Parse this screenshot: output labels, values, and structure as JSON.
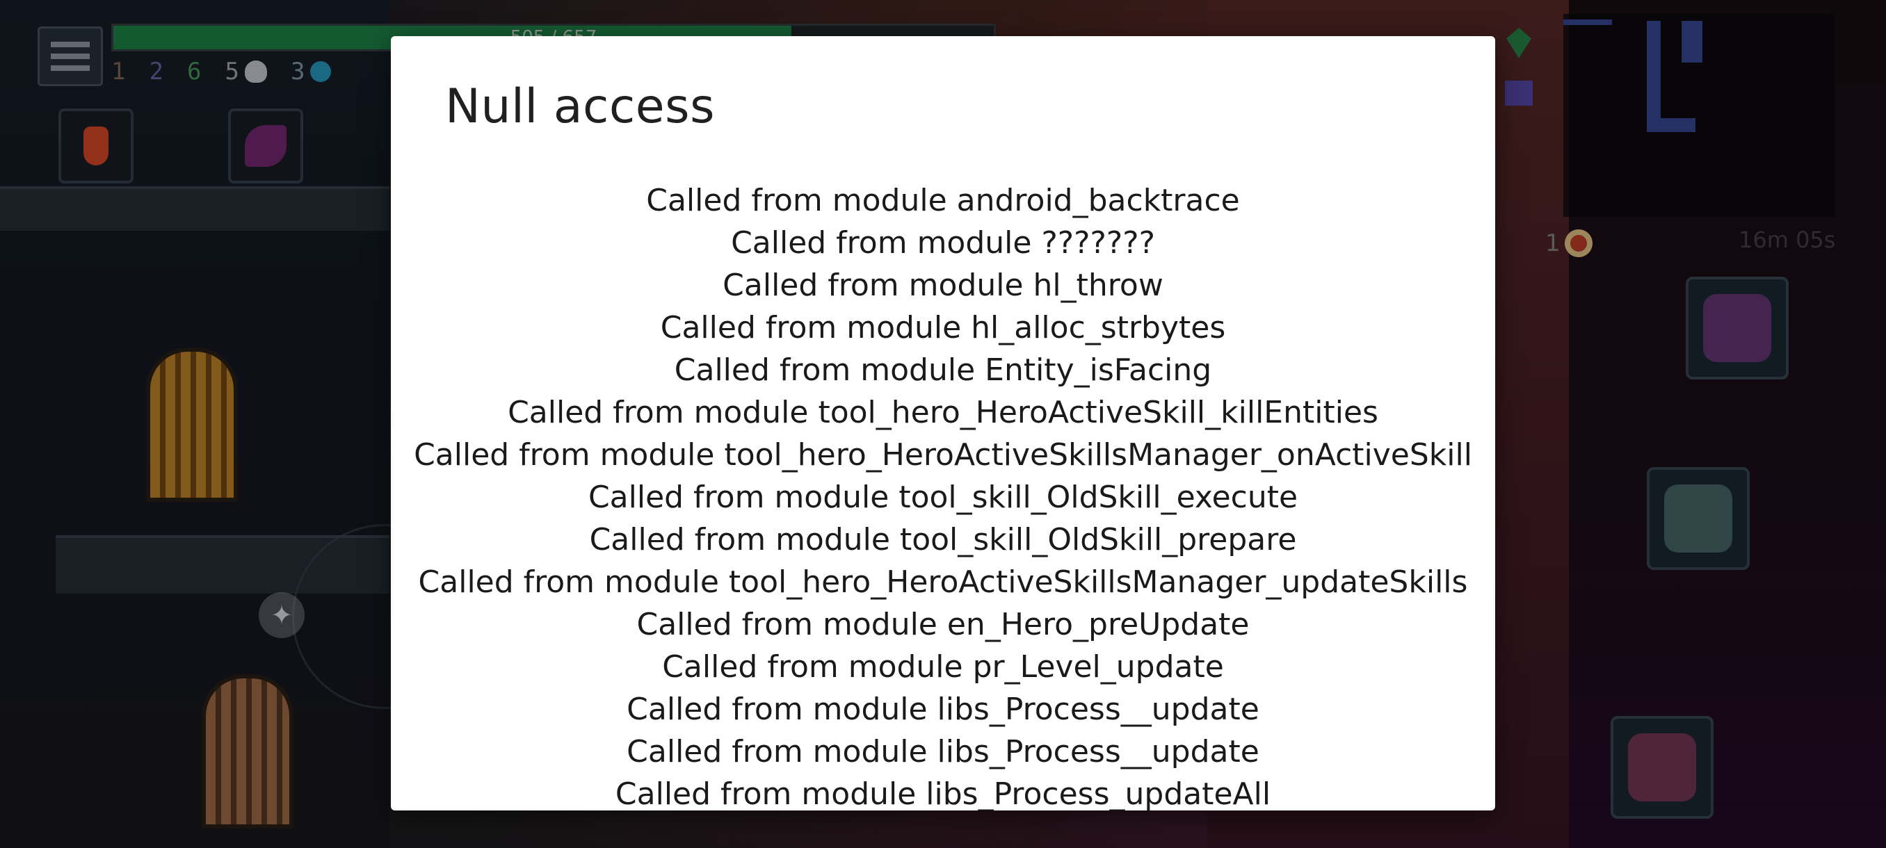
{
  "game_hud": {
    "health_text": "505 / 657",
    "health_fraction": 0.77,
    "stats": [
      {
        "value": "1",
        "color": "#8a6a5a"
      },
      {
        "value": "2",
        "color": "#6a6aa8"
      },
      {
        "value": "6",
        "color": "#4aa05a"
      },
      {
        "value": "5",
        "color": "#b0b0b8",
        "icon": "skull-icon"
      },
      {
        "value": "3",
        "color": "#8aa0b0",
        "icon": "cell-icon"
      }
    ],
    "timer": "16m 05s",
    "level_badge": "1"
  },
  "dialog": {
    "title": "Null access",
    "trace": [
      "Called from module android_backtrace",
      "Called from module ???????",
      "Called from module hl_throw",
      "Called from module hl_alloc_strbytes",
      "Called from module Entity_isFacing",
      "Called from module tool_hero_HeroActiveSkill_killEntities",
      "Called from module tool_hero_HeroActiveSkillsManager_onActiveSkill",
      "Called from module tool_skill_OldSkill_execute",
      "Called from module tool_skill_OldSkill_prepare",
      "Called from module tool_hero_HeroActiveSkillsManager_updateSkills",
      "Called from module en_Hero_preUpdate",
      "Called from module pr_Level_update",
      "Called from module libs_Process__update",
      "Called from module libs_Process__update",
      "Called from module libs_Process_updateAll"
    ]
  },
  "icons": {
    "menu": "hamburger-menu-icon",
    "joystick": "crosshair-icon"
  }
}
